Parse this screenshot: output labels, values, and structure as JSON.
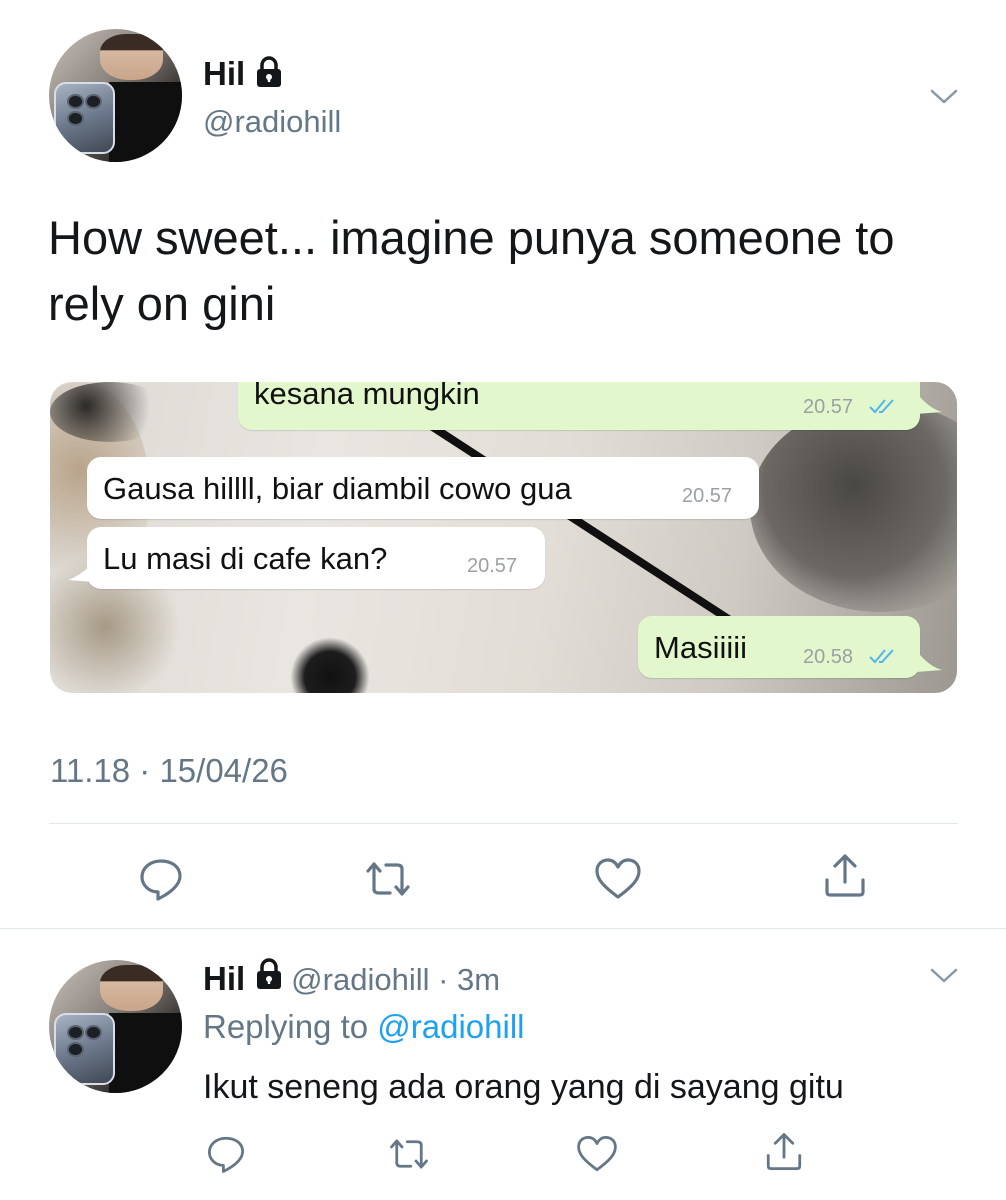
{
  "tweet": {
    "display_name": "Hil",
    "handle": "@radiohill",
    "text": "How sweet... imagine punya someone to rely on gini",
    "timestamp": "11.18 · 15/04/26",
    "media": {
      "messages": [
        {
          "direction": "outgoing",
          "text": "kesana mungkin",
          "time": "20.57",
          "read": true
        },
        {
          "direction": "incoming",
          "text": "Gausa hillll, biar diambil cowo gua",
          "time": "20.57"
        },
        {
          "direction": "incoming",
          "text": "Lu masi di cafe kan?",
          "time": "20.57"
        },
        {
          "direction": "outgoing",
          "text": "Masiiiii",
          "time": "20.58",
          "read": true
        }
      ]
    },
    "actions": [
      "reply-icon",
      "retweet-icon",
      "like-icon",
      "share-icon"
    ]
  },
  "reply": {
    "display_name": "Hil",
    "handle_time": "@radiohill · 3m",
    "replying_prefix": "Replying to",
    "replying_to": "@radiohill",
    "text": "Ikut seneng ada orang yang di sayang gitu",
    "actions": [
      "reply-icon",
      "retweet-icon",
      "like-icon",
      "share-icon"
    ]
  },
  "colors": {
    "secondary_text": "#657786",
    "link": "#1da1f2",
    "outgoing_bubble": "#e2f8cc",
    "read_ticks": "#4fb6ec"
  }
}
